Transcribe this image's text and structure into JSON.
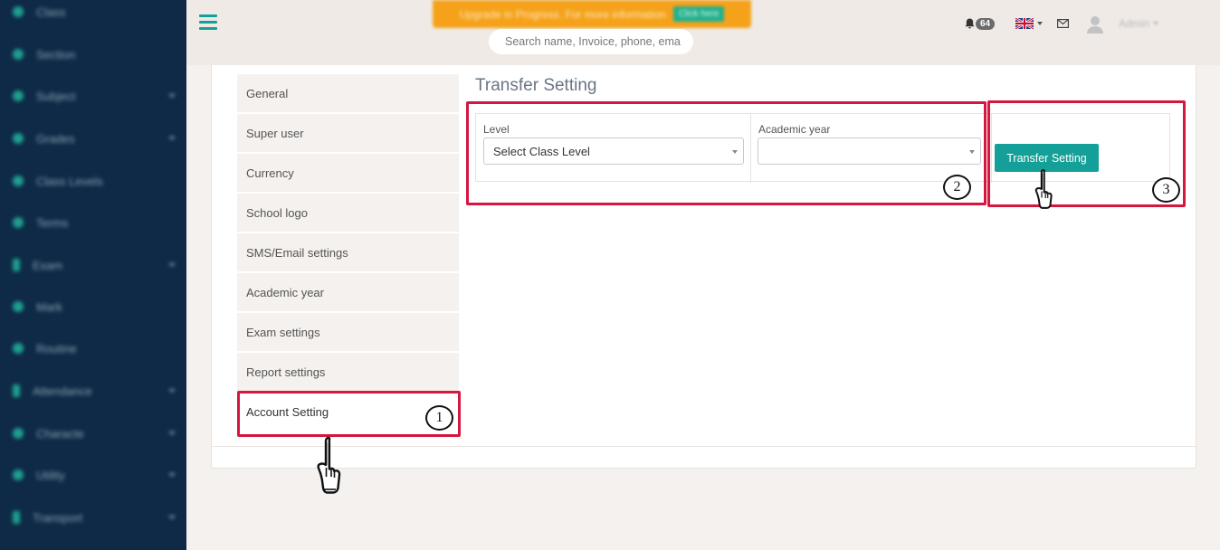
{
  "sidebar": {
    "items": [
      {
        "label": "Class",
        "has_arrow": false
      },
      {
        "label": "Section",
        "has_arrow": false
      },
      {
        "label": "Subject",
        "has_arrow": true
      },
      {
        "label": "Grades",
        "has_arrow": true
      },
      {
        "label": "Class Levels",
        "has_arrow": false
      },
      {
        "label": "Terms",
        "has_arrow": false
      },
      {
        "label": "Exam",
        "has_arrow": true
      },
      {
        "label": "Mark",
        "has_arrow": false
      },
      {
        "label": "Routine",
        "has_arrow": false
      },
      {
        "label": "Attendance",
        "has_arrow": true
      },
      {
        "label": "Characte",
        "has_arrow": true
      },
      {
        "label": "Utility",
        "has_arrow": true
      },
      {
        "label": "Transport",
        "has_arrow": true
      }
    ]
  },
  "header": {
    "promo_text": "Upgrade in Progress. For more information",
    "promo_button": "Click here",
    "search_placeholder": "Search name, Invoice, phone, ema",
    "notification_count": "64",
    "user_name": "Admin"
  },
  "settings_menu": {
    "items": [
      "General",
      "Super user",
      "Currency",
      "School logo",
      "SMS/Email settings",
      "Academic year",
      "Exam settings",
      "Report settings",
      "Account Setting"
    ],
    "active_index": 8
  },
  "main": {
    "title": "Transfer Setting",
    "level_label": "Level",
    "level_value": "Select Class Level",
    "year_label": "Academic year",
    "year_value": "",
    "submit_label": "Transfer Setting"
  },
  "annotations": {
    "step1": "1",
    "step2": "2",
    "step3": "3",
    "color": "#d5163e"
  },
  "colors": {
    "accent": "#14a098",
    "sidebar_bg": "#0e2a47",
    "promo_bg": "#f5a21a"
  }
}
